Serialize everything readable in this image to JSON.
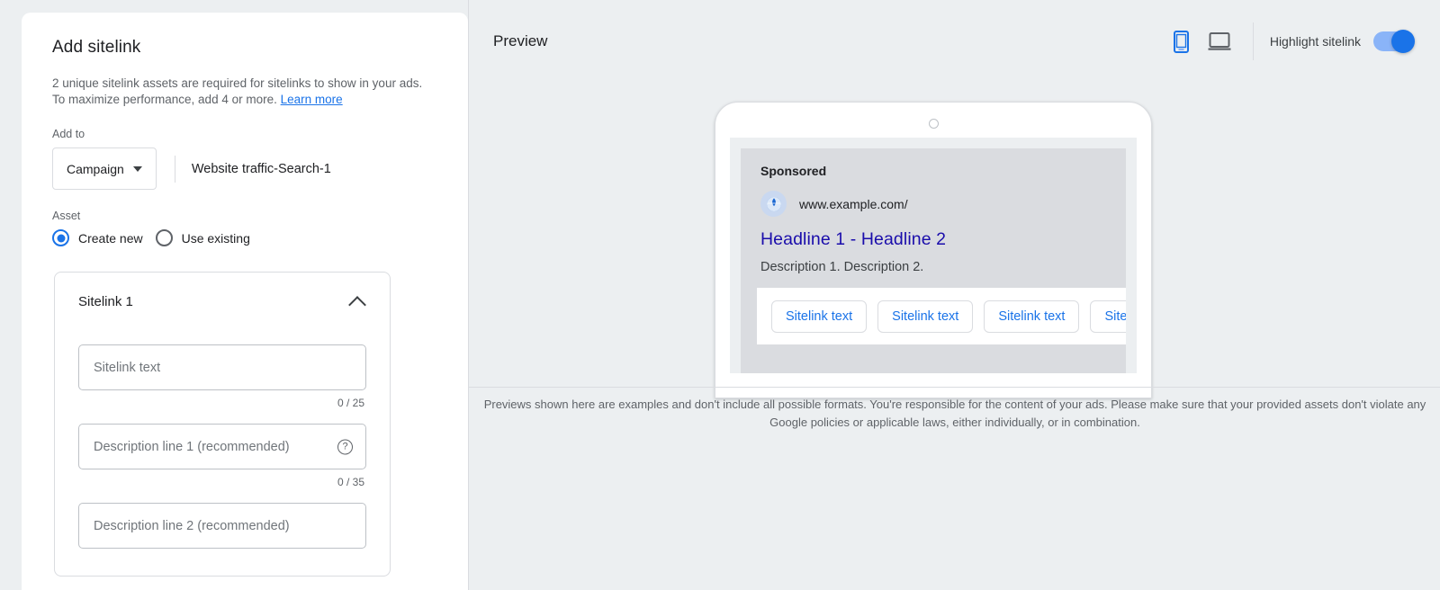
{
  "dialog": {
    "title": "Add sitelink",
    "description": "2 unique sitelink assets are required for sitelinks to show in your ads. To maximize performance, add 4 or more.",
    "learn_more": "Learn more"
  },
  "add_to": {
    "label": "Add to",
    "selected": "Campaign",
    "value": "Website traffic-Search-1"
  },
  "asset": {
    "label": "Asset",
    "options": [
      {
        "label": "Create new",
        "selected": true
      },
      {
        "label": "Use existing",
        "selected": false
      }
    ]
  },
  "sitelink_card": {
    "title": "Sitelink 1",
    "collapse_icon": "chevron-up-icon",
    "fields": [
      {
        "placeholder": "Sitelink text",
        "counter": "0 / 25",
        "help": false
      },
      {
        "placeholder": "Description line 1 (recommended)",
        "counter": "0 / 35",
        "help": true,
        "help_glyph": "?"
      },
      {
        "placeholder": "Description line 2 (recommended)",
        "counter": "",
        "help": false
      }
    ]
  },
  "preview": {
    "title": "Preview",
    "devices": [
      {
        "name": "mobile-preview-icon",
        "active": true
      },
      {
        "name": "desktop-preview-icon",
        "active": false
      }
    ],
    "highlight_toggle": {
      "label": "Highlight sitelink",
      "on": true
    },
    "ad": {
      "sponsored": "Sponsored",
      "favicon": "globe-icon",
      "url": "www.example.com/",
      "headline": "Headline 1 - Headline 2",
      "description": "Description 1. Description 2.",
      "sitelinks": [
        "Sitelink text",
        "Sitelink text",
        "Sitelink text",
        "Sitelink text"
      ]
    },
    "footer_note": "Previews shown here are examples and don't include all possible formats. You're responsible for the content of your ads. Please make sure that your provided assets don't violate any Google policies or applicable laws, either individually, or in combination."
  },
  "colors": {
    "accent": "#1a73e8",
    "link": "#1a0dab",
    "toggle_track": "#8ab4f8",
    "panel_bg": "#eceff1"
  }
}
